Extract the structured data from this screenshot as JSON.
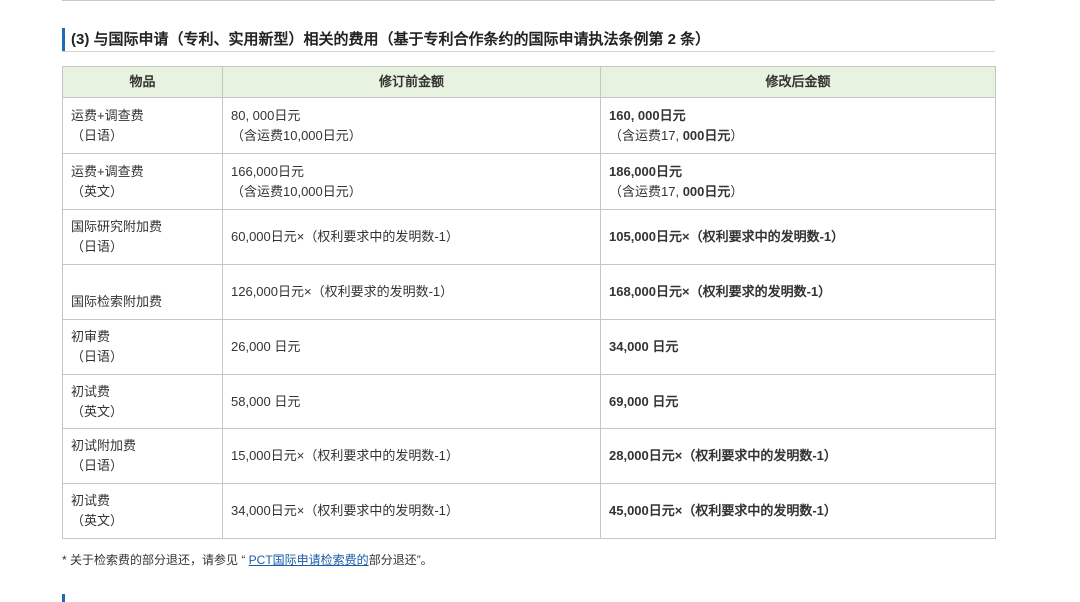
{
  "theme": {
    "accent": "#1f6bb5",
    "link": "#1a5aa6",
    "header_bg": "#e8f3df",
    "border": "#c6c6c6"
  },
  "section": {
    "heading": "(3) 与国际申请（专利、实用新型）相关的费用（基于专利合作条约的国际申请执法条例第 2 条）"
  },
  "table": {
    "headers": [
      "物品",
      "修订前金额",
      "修改后金额"
    ],
    "rows": [
      {
        "item": [
          "运费+调查费",
          "（日语）"
        ],
        "before": [
          "80, 000日元",
          "（含运费10,000日元）"
        ],
        "after": [
          "160, 000日元"
        ],
        "after_note": {
          "pre": "（含运费17, ",
          "bold": "000日元",
          "post": "）"
        }
      },
      {
        "item": [
          "运费+调查费",
          "（英文）"
        ],
        "before": [
          "166,000日元",
          "（含运费10,000日元）"
        ],
        "after": [
          "186,000日元"
        ],
        "after_note": {
          "pre": "（含运费17, ",
          "bold": "000日元",
          "post": "）"
        }
      },
      {
        "item": [
          "国际研究附加费",
          "（日语）"
        ],
        "before": [
          "60,000日元×（权利要求中的发明数-1）"
        ],
        "after": [
          "105,000日元×（权利要求中的发明数-1）"
        ]
      },
      {
        "item": [
          "国际检索附加费"
        ],
        "before": [
          "126,000日元×（权利要求的发明数-1）"
        ],
        "after": [
          "168,000日元×（权利要求的发明数-1）"
        ]
      },
      {
        "item": [
          "初审费",
          "（日语）"
        ],
        "before": [
          "26,000 日元"
        ],
        "after": [
          "34,000 日元"
        ]
      },
      {
        "item": [
          "初试费",
          "（英文）"
        ],
        "before": [
          "58,000 日元"
        ],
        "after": [
          "69,000 日元"
        ]
      },
      {
        "item": [
          "初试附加费",
          "（日语）"
        ],
        "before": [
          "15,000日元×（权利要求中的发明数-1）"
        ],
        "after": [
          "28,000日元×（权利要求中的发明数-1）"
        ]
      },
      {
        "item": [
          "初试费",
          "（英文）"
        ],
        "before": [
          "34,000日元×（权利要求中的发明数-1）"
        ],
        "after": [
          "45,000日元×（权利要求中的发明数-1）"
        ]
      }
    ]
  },
  "footnote": {
    "prefix": "* 关于检索费的部分退还，请参见 “ ",
    "link": "PCT国际申请检索费的",
    "suffix": "部分退还”。"
  }
}
